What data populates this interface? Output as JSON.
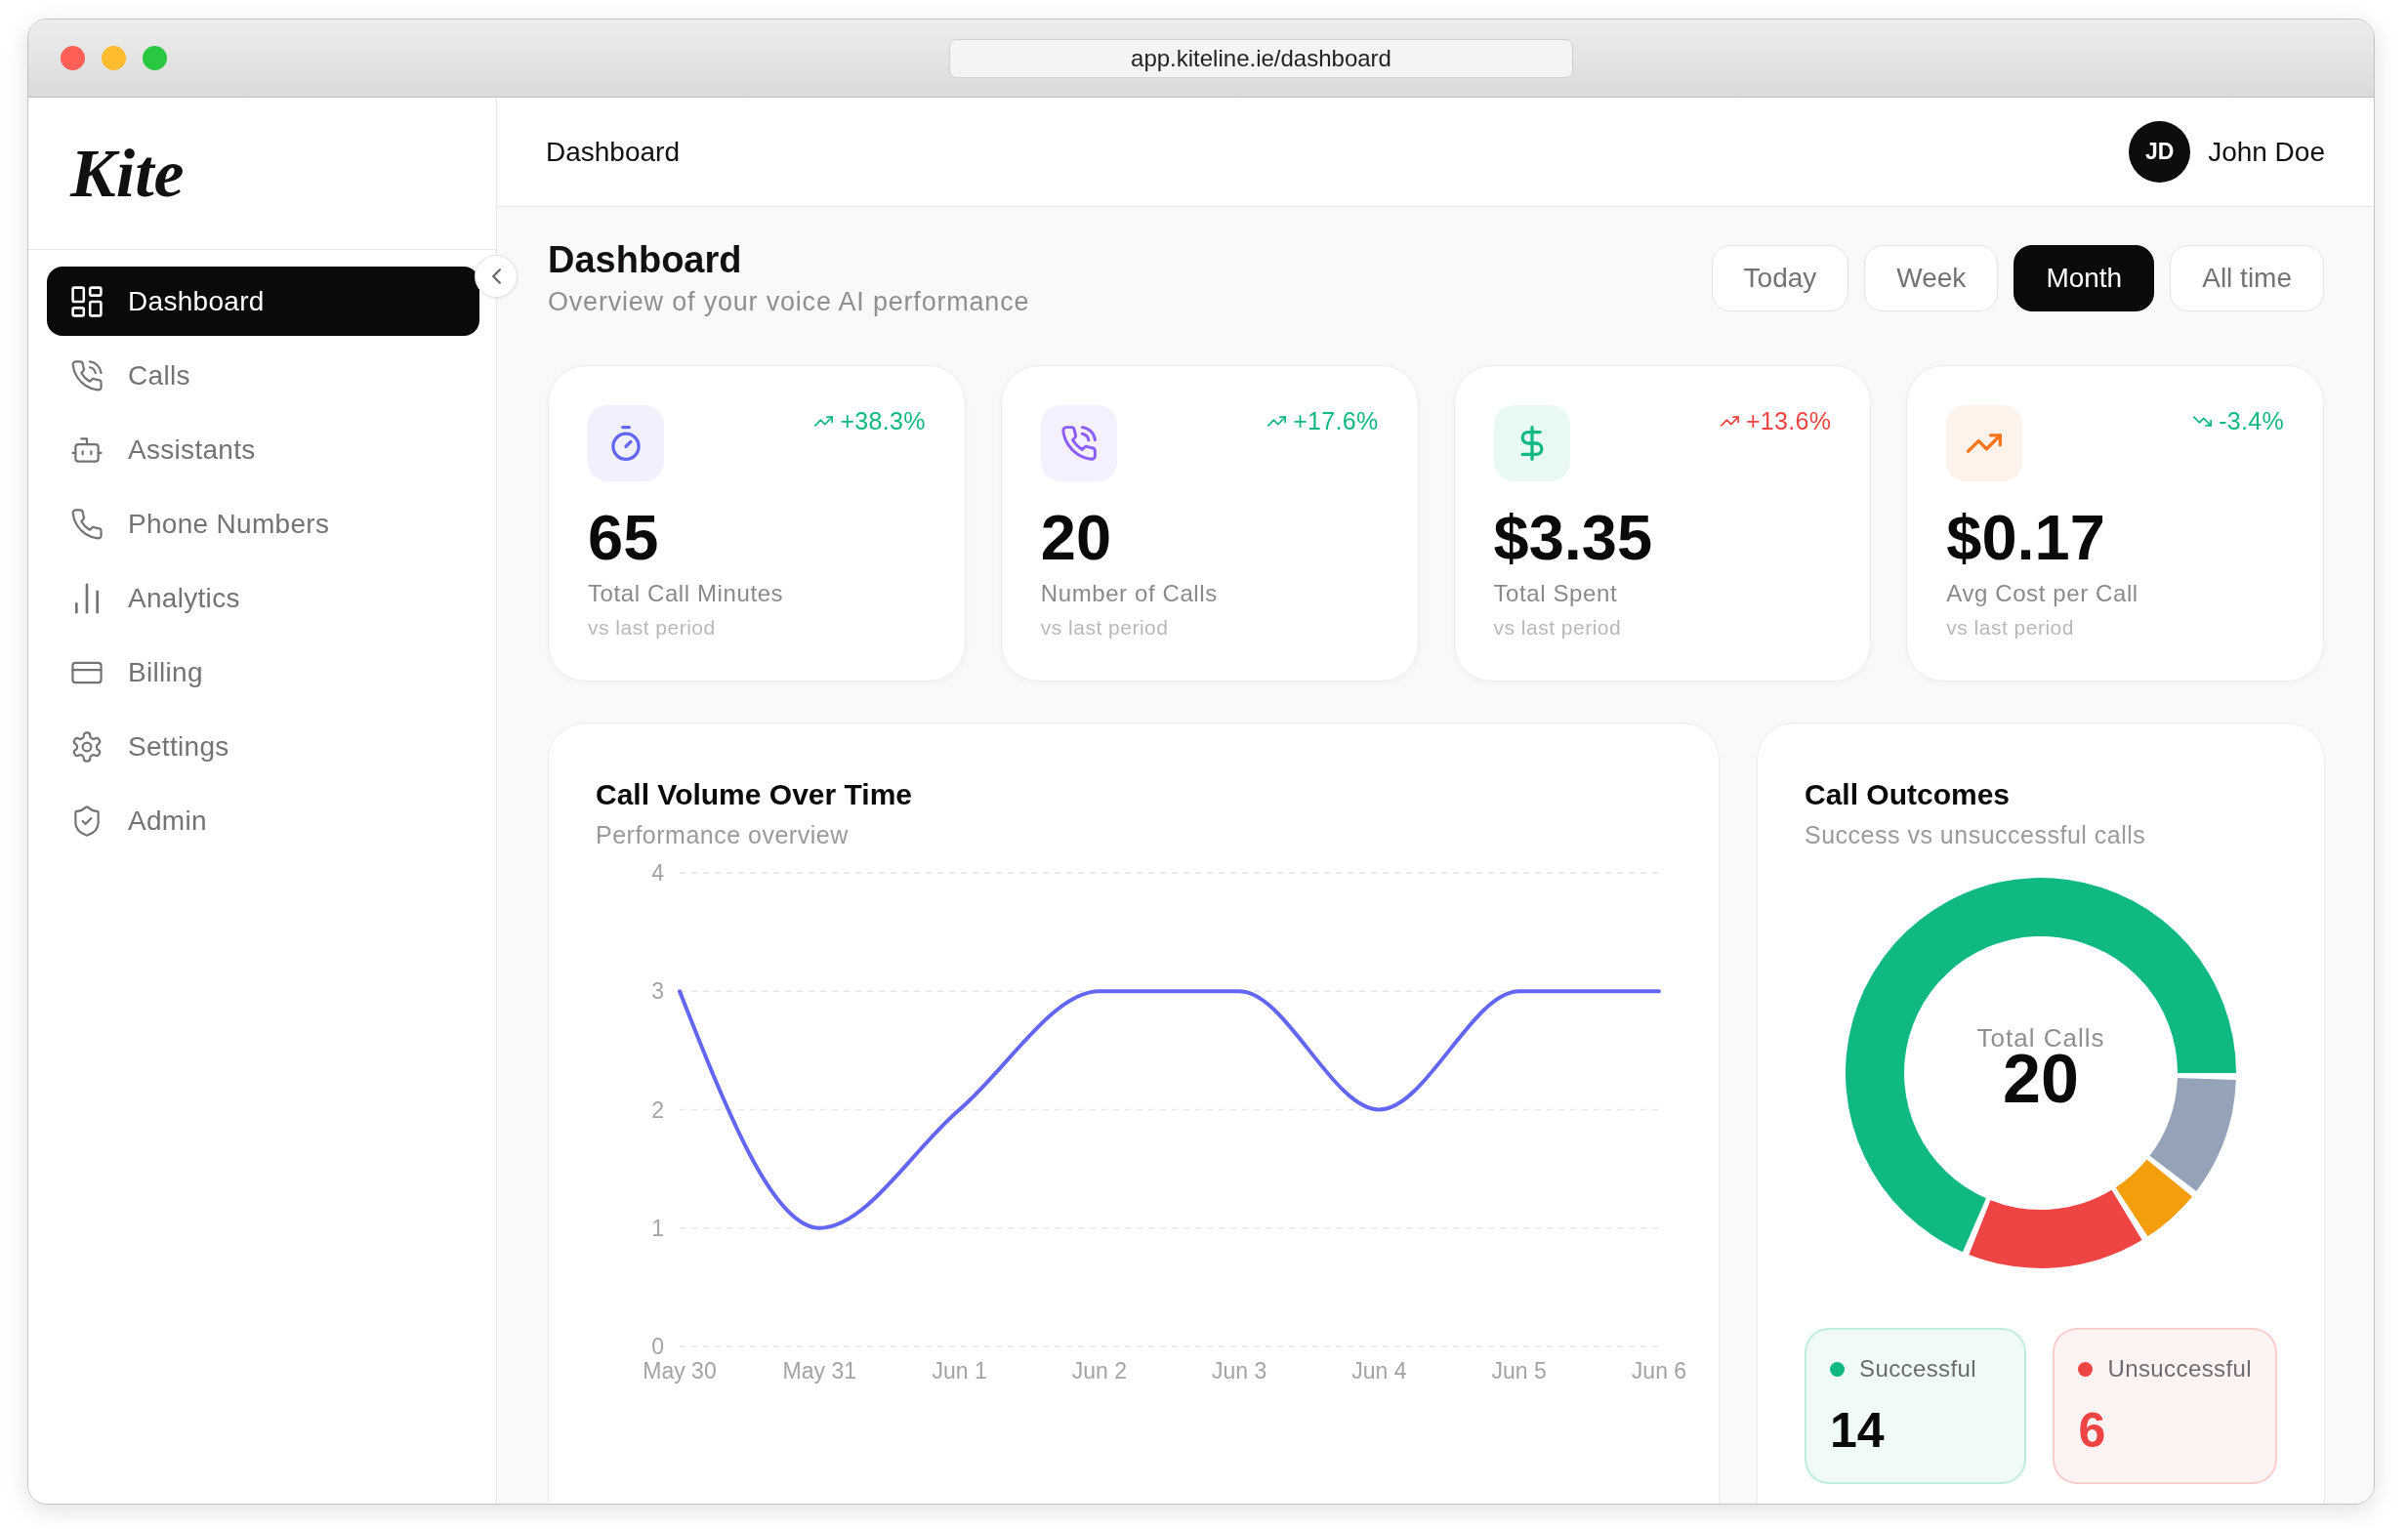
{
  "browser": {
    "url": "app.kiteline.ie/dashboard"
  },
  "sidebar": {
    "logo": "Kite",
    "items": [
      {
        "label": "Dashboard",
        "selected": true
      },
      {
        "label": "Calls",
        "selected": false
      },
      {
        "label": "Assistants",
        "selected": false
      },
      {
        "label": "Phone Numbers",
        "selected": false
      },
      {
        "label": "Analytics",
        "selected": false
      },
      {
        "label": "Billing",
        "selected": false
      },
      {
        "label": "Settings",
        "selected": false
      },
      {
        "label": "Admin",
        "selected": false
      }
    ]
  },
  "header": {
    "title": "Dashboard",
    "user": {
      "initials": "JD",
      "name": "John Doe"
    }
  },
  "page": {
    "title": "Dashboard",
    "subtitle": "Overview of your voice AI performance"
  },
  "periods": [
    {
      "label": "Today",
      "selected": false
    },
    {
      "label": "Week",
      "selected": false
    },
    {
      "label": "Month",
      "selected": true
    },
    {
      "label": "All time",
      "selected": false
    }
  ],
  "stats": [
    {
      "value": "65",
      "label": "Total Call Minutes",
      "note": "vs last period",
      "color": "#6366f1",
      "trend": {
        "kind": "up",
        "text": "+38.3%",
        "color": "#10b981"
      }
    },
    {
      "value": "20",
      "label": "Number of Calls",
      "note": "vs last period",
      "color": "#8b5cf6",
      "trend": {
        "kind": "up",
        "text": "+17.6%",
        "color": "#10b981"
      }
    },
    {
      "value": "$3.35",
      "label": "Total Spent",
      "note": "vs last period",
      "color": "#10b981",
      "trend": {
        "kind": "up",
        "text": "+13.6%",
        "color": "#ef4444"
      }
    },
    {
      "value": "$0.17",
      "label": "Avg Cost per Call",
      "note": "vs last period",
      "color": "#f97316",
      "trend": {
        "kind": "down",
        "text": "-3.4%",
        "color": "#10b981"
      }
    }
  ],
  "call_volume": {
    "title": "Call Volume Over Time",
    "subtitle": "Performance overview",
    "chart_data": {
      "type": "line",
      "categories": [
        "May 30",
        "May 31",
        "Jun 1",
        "Jun 2",
        "Jun 3",
        "Jun 4",
        "Jun 5",
        "Jun 6"
      ],
      "series": [
        {
          "color": "#6366f1",
          "values": [
            3,
            1,
            2,
            3,
            3,
            2,
            3,
            3
          ]
        }
      ],
      "ylim": [
        0,
        4
      ],
      "yticks": [
        0,
        1,
        2,
        3,
        4
      ],
      "grid": true
    }
  },
  "call_outcomes": {
    "title": "Call Outcomes",
    "subtitle": "Success vs unsuccessful calls",
    "center_label": "Total Calls",
    "center_value": "20",
    "chart_data": {
      "type": "donut",
      "values": [
        70,
        15,
        5,
        10
      ],
      "colors": [
        "#10b981",
        "#ef4444",
        "#f59e0b",
        "#94a3b8"
      ]
    },
    "outcomes": [
      {
        "kind": "success",
        "label": "Successful",
        "value": "14",
        "color": "#10b981"
      },
      {
        "kind": "failure",
        "label": "Unsuccessful",
        "value": "6",
        "color": "#ef4444"
      }
    ]
  }
}
